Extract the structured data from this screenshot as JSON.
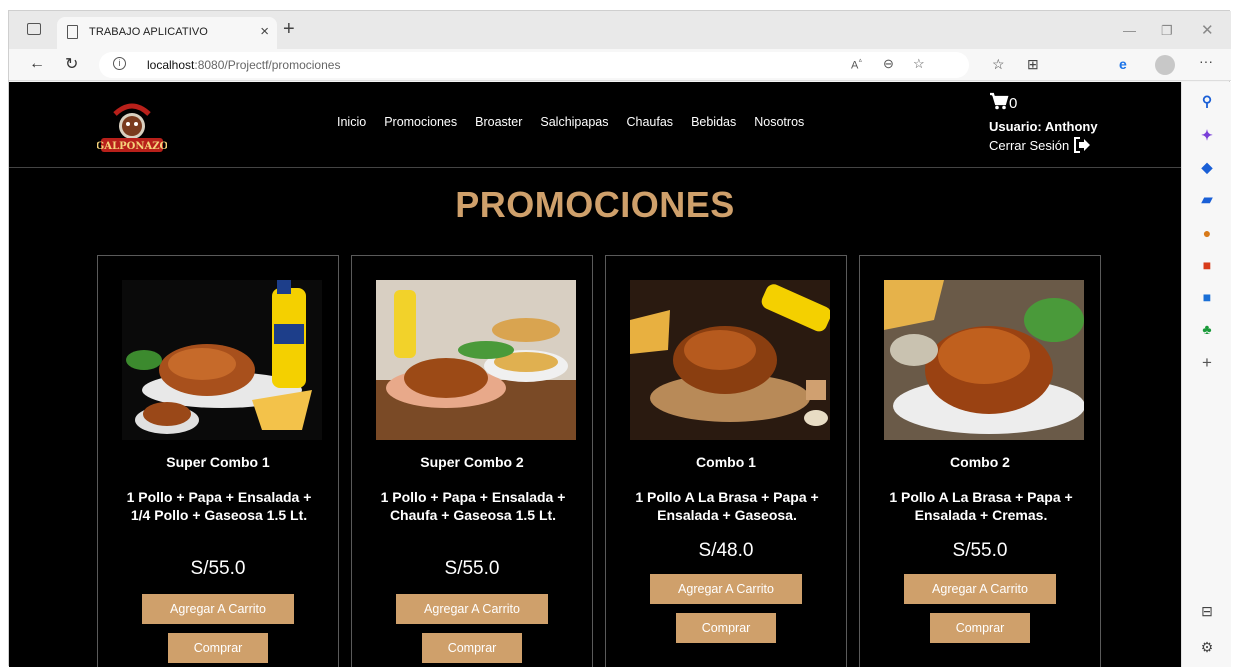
{
  "browser": {
    "tab_title": "TRABAJO APLICATIVO",
    "tab_close": "×",
    "new_tab": "+",
    "url_host": "localhost",
    "url_path": ":8080/Projectf/promociones"
  },
  "site": {
    "logo_text": "GALPONAZO",
    "nav": [
      "Inicio",
      "Promociones",
      "Broaster",
      "Salchipapas",
      "Chaufas",
      "Bebidas",
      "Nosotros"
    ],
    "cart_count": "0",
    "user_label": "Usuario: Anthony",
    "logout_label": "Cerrar Sesión"
  },
  "page": {
    "title": "PROMOCIONES"
  },
  "products": [
    {
      "name": "Super Combo 1",
      "desc": "1 Pollo + Papa + Ensalada + 1/4 Pollo + Gaseosa 1.5 Lt.",
      "price": "S/55.0",
      "add_label": "Agregar A Carrito",
      "buy_label": "Comprar"
    },
    {
      "name": "Super Combo 2",
      "desc": "1 Pollo + Papa + Ensalada + Chaufa + Gaseosa 1.5 Lt.",
      "price": "S/55.0",
      "add_label": "Agregar A Carrito",
      "buy_label": "Comprar"
    },
    {
      "name": "Combo 1",
      "desc": "1 Pollo A La Brasa + Papa + Ensalada + Gaseosa.",
      "price": "S/48.0",
      "add_label": "Agregar A Carrito",
      "buy_label": "Comprar"
    },
    {
      "name": "Combo 2",
      "desc": "1 Pollo A La Brasa + Papa + Ensalada + Cremas.",
      "price": "S/55.0",
      "add_label": "Agregar A Carrito",
      "buy_label": "Comprar"
    }
  ],
  "colors": {
    "accent": "#cfa06b",
    "background": "#000000"
  },
  "icons": [
    "tab-actions-icon",
    "page-icon",
    "back-icon",
    "refresh-icon",
    "info-icon",
    "read-aloud-icon",
    "zoom-icon",
    "favorite-add-icon",
    "favorites-icon",
    "collections-icon",
    "edge-icon",
    "profile-icon",
    "more-icon",
    "cart-icon",
    "logout-icon"
  ]
}
